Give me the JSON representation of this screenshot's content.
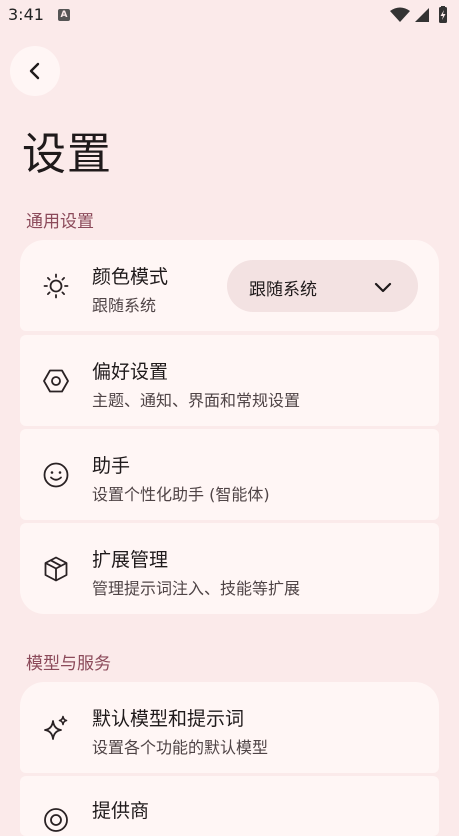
{
  "status_bar": {
    "time": "3:41",
    "notification_letter": "A"
  },
  "page": {
    "title": "设置"
  },
  "sections": [
    {
      "header": "通用设置",
      "items": [
        {
          "title": "颜色模式",
          "subtitle": "跟随系统",
          "icon": "sun-icon",
          "dropdown_value": "跟随系统"
        },
        {
          "title": "偏好设置",
          "subtitle": "主题、通知、界面和常规设置",
          "icon": "hexagon-settings-icon"
        },
        {
          "title": "助手",
          "subtitle": "设置个性化助手 (智能体)",
          "icon": "smiley-icon"
        },
        {
          "title": "扩展管理",
          "subtitle": "管理提示词注入、技能等扩展",
          "icon": "package-icon"
        }
      ]
    },
    {
      "header": "模型与服务",
      "items": [
        {
          "title": "默认模型和提示词",
          "subtitle": "设置各个功能的默认模型",
          "icon": "sparkles-icon"
        },
        {
          "title": "提供商",
          "subtitle": "",
          "icon": "provider-icon"
        }
      ]
    }
  ],
  "colors": {
    "background": "#fbeaea",
    "card": "#fff6f5",
    "section_header": "#8b4a5a",
    "dropdown": "#f3e2e2"
  }
}
